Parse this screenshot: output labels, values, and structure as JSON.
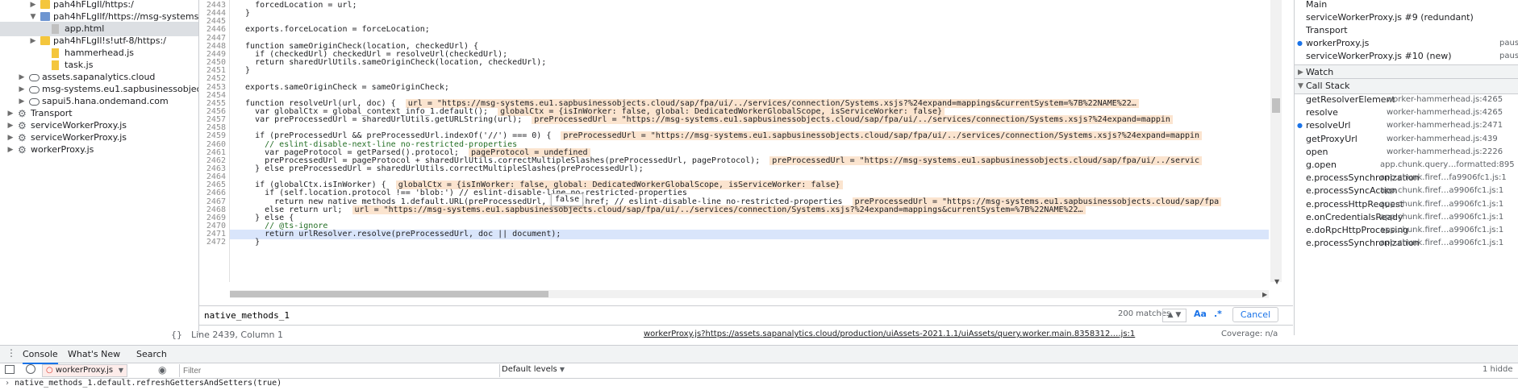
{
  "navigator": {
    "items": [
      {
        "label": "pah4hFLgIl/https:/",
        "indent": 28,
        "icon": "folder-icon",
        "expanded": false
      },
      {
        "label": "pah4hFLgIlf/https://msg-systems.eu1.sap",
        "indent": 28,
        "icon": "folder-icon",
        "expanded": true
      },
      {
        "label": "app.html",
        "indent": 42,
        "icon": "file-icon",
        "expanded": null,
        "selected": true
      },
      {
        "label": "pah4hFLgIl!s!utf-8/https:/",
        "indent": 28,
        "icon": "folder-icon",
        "expanded": false
      },
      {
        "label": "hammerhead.js",
        "indent": 42,
        "icon": "file-icon",
        "expanded": null
      },
      {
        "label": "task.js",
        "indent": 42,
        "icon": "file-icon",
        "expanded": null
      },
      {
        "label": "assets.sapanalytics.cloud",
        "indent": 14,
        "icon": "cloud-icon",
        "expanded": false
      },
      {
        "label": "msg-systems.eu1.sapbusinessobjects.cloud",
        "indent": 14,
        "icon": "cloud-icon",
        "expanded": false
      },
      {
        "label": "sapui5.hana.ondemand.com",
        "indent": 14,
        "icon": "cloud-icon",
        "expanded": false
      },
      {
        "label": "Transport",
        "indent": 0,
        "icon": "gear-icon",
        "expanded": false
      },
      {
        "label": "serviceWorkerProxy.js",
        "indent": 0,
        "icon": "gear-icon",
        "expanded": false
      },
      {
        "label": "serviceWorkerProxy.js",
        "indent": 0,
        "icon": "gear-icon",
        "expanded": false
      },
      {
        "label": "workerProxy.js",
        "indent": 0,
        "icon": "gear-icon",
        "expanded": false
      }
    ]
  },
  "editor": {
    "lines": [
      {
        "n": "2443",
        "code": "    forcedLocation = url;"
      },
      {
        "n": "2444",
        "code": "  }"
      },
      {
        "n": "2445",
        "code": ""
      },
      {
        "n": "2446",
        "code": "  exports.forceLocation = forceLocation;"
      },
      {
        "n": "2447",
        "code": ""
      },
      {
        "n": "2448",
        "code": "  function sameOriginCheck(location, checkedUrl) {"
      },
      {
        "n": "2449",
        "code": "    if (checkedUrl) checkedUrl = resolveUrl(checkedUrl);"
      },
      {
        "n": "2450",
        "code": "    return sharedUrlUtils.sameOriginCheck(location, checkedUrl);"
      },
      {
        "n": "2451",
        "code": "  }"
      },
      {
        "n": "2452",
        "code": ""
      },
      {
        "n": "2453",
        "code": "  exports.sameOriginCheck = sameOriginCheck;"
      },
      {
        "n": "2454",
        "code": ""
      },
      {
        "n": "2455",
        "code": "  function resolveUrl(url, doc) {",
        "inline": "url = \"https://msg-systems.eu1.sapbusinessobjects.cloud/sap/fpa/ui/../services/connection/Systems.xsjs?%24expand=mappings&currentSystem=%7B%22NAME%22…"
      },
      {
        "n": "2456",
        "code": "    var globalCtx = global_context_info_1.default();",
        "inline": "globalCtx = {isInWorker: false, global: DedicatedWorkerGlobalScope, isServiceWorker: false}"
      },
      {
        "n": "2457",
        "code": "    var preProcessedUrl = sharedUrlUtils.getURLString(url);",
        "inline": "preProcessedUrl = \"https://msg-systems.eu1.sapbusinessobjects.cloud/sap/fpa/ui/../services/connection/Systems.xsjs?%24expand=mappin"
      },
      {
        "n": "2458",
        "code": ""
      },
      {
        "n": "2459",
        "code": "    if (preProcessedUrl && preProcessedUrl.indexOf('//') === 0) {",
        "inline": "preProcessedUrl = \"https://msg-systems.eu1.sapbusinessobjects.cloud/sap/fpa/ui/../services/connection/Systems.xsjs?%24expand=mappin"
      },
      {
        "n": "2460",
        "code": "      // eslint-disable-next-line no-restricted-properties"
      },
      {
        "n": "2461",
        "code": "      var pageProtocol = getParsed().protocol;",
        "inline": "pageProtocol = undefined"
      },
      {
        "n": "2462",
        "code": "      preProcessedUrl = pageProtocol + sharedUrlUtils.correctMultipleSlashes(preProcessedUrl, pageProtocol);",
        "inline": "preProcessedUrl = \"https://msg-systems.eu1.sapbusinessobjects.cloud/sap/fpa/ui/../servic"
      },
      {
        "n": "2463",
        "code": "    } else preProcessedUrl = sharedUrlUtils.correctMultipleSlashes(preProcessedUrl);"
      },
      {
        "n": "2464",
        "code": ""
      },
      {
        "n": "2465",
        "code": "    if (globalCtx.isInWorker) {",
        "inline": "globalCtx = {isInWorker: false, global: DedicatedWorkerGlobalScope, isServiceWorker: false}"
      },
      {
        "n": "2466",
        "code": "      if (self.location.protocol !== 'blob:') // eslint-disable-line no-restricted-properties"
      },
      {
        "n": "2467",
        "code": "        return new native_methods_1.default.URL(preProcessedUrl, get()).href; // eslint-disable-line no-restricted-properties",
        "inline": "preProcessedUrl = \"https://msg-systems.eu1.sapbusinessobjects.cloud/sap/fpa"
      },
      {
        "n": "2468",
        "code": "      else return url;",
        "inline": "url = \"https://msg-systems.eu1.sapbusinessobjects.cloud/sap/fpa/ui/../services/connection/Systems.xsjs?%24expand=mappings&currentSystem=%7B%22NAME%22…"
      },
      {
        "n": "2469",
        "code": "    } else {"
      },
      {
        "n": "2470",
        "code": "      // @ts-ignore"
      },
      {
        "n": "2471",
        "code": "      return urlResolver.resolve(preProcessedUrl, doc || document);",
        "highlight": true
      },
      {
        "n": "2472",
        "code": "    }"
      }
    ],
    "tooltip": "false"
  },
  "search": {
    "value": "native_methods_1",
    "matches": "200 matches",
    "match_case": "Aa",
    "regex": ".*",
    "cancel": "Cancel"
  },
  "status": {
    "braces": "{}",
    "position": "Line 2439, Column 1",
    "source": "workerProxy.js?https://assets.sapanalytics.cloud/production/uiAssets-2021.1.1/uiAssets/query.worker.main.8358312….js:1",
    "coverage": "Coverage: n/a"
  },
  "threads": [
    {
      "name": "Main",
      "state": "",
      "current": false
    },
    {
      "name": "serviceWorkerProxy.js #9 (redundant)",
      "state": "",
      "current": false
    },
    {
      "name": "Transport",
      "state": "",
      "current": false
    },
    {
      "name": "workerProxy.js",
      "state": "pausec",
      "current": true
    },
    {
      "name": "serviceWorkerProxy.js #10 (new)",
      "state": "pausec",
      "current": false
    }
  ],
  "sections": {
    "watch": "Watch",
    "call_stack": "Call Stack"
  },
  "call_stack": [
    {
      "fn": "getResolverElement",
      "loc": "worker-hammerhead.js:4265",
      "current": false
    },
    {
      "fn": "resolve",
      "loc": "worker-hammerhead.js:4265",
      "current": false
    },
    {
      "fn": "resolveUrl",
      "loc": "worker-hammerhead.js:2471",
      "current": true
    },
    {
      "fn": "getProxyUrl",
      "loc": "worker-hammerhead.js:439",
      "current": false
    },
    {
      "fn": "open",
      "loc": "worker-hammerhead.js:2226",
      "current": false
    },
    {
      "fn": "g.open",
      "loc": "app.chunk.query…formatted:895",
      "current": false
    },
    {
      "fn": "e.processSynchronization",
      "loc": "app.chunk.firef…fa9906fc1.js:1",
      "current": false
    },
    {
      "fn": "e.processSyncAction",
      "loc": "app.chunk.firef…a9906fc1.js:1",
      "current": false
    },
    {
      "fn": "e.processHttpRequest",
      "loc": "app.chunk.firef…a9906fc1.js:1",
      "current": false
    },
    {
      "fn": "e.onCredentialsReady",
      "loc": "app.chunk.firef…a9906fc1.js:1",
      "current": false
    },
    {
      "fn": "e.doRpcHttpProcessing",
      "loc": "app.chunk.firef…a9906fc1.js:1",
      "current": false
    },
    {
      "fn": "e.processSynchronization",
      "loc": "app.chunk.firef…a9906fc1.js:1",
      "current": false
    }
  ],
  "drawer": {
    "tabs": [
      "Console",
      "What's New",
      "Search"
    ],
    "context": "workerProxy.js",
    "filter_placeholder": "Filter",
    "levels": "Default levels",
    "hidden": "1 hidde",
    "output": "native_methods_1.default.refreshGettersAndSetters(true)"
  },
  "colors": {
    "accent": "#1a73e8",
    "selection": "#d9e5fb",
    "inline_value": "#fbe4cf"
  }
}
